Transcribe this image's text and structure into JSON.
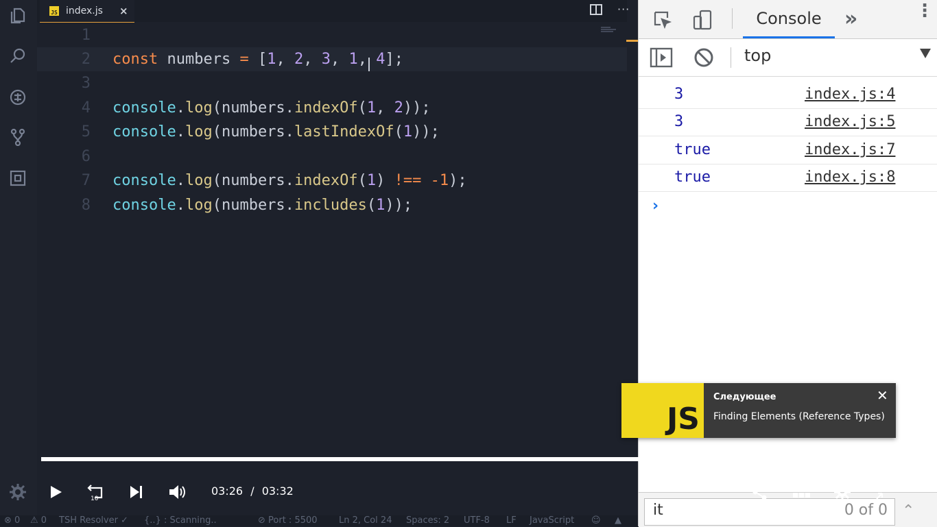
{
  "editor": {
    "tab": {
      "label": "index.js",
      "badge": "JS",
      "close": "×"
    },
    "more": "···",
    "lines": [
      {
        "num": "1"
      },
      {
        "num": "2"
      },
      {
        "num": "3"
      },
      {
        "num": "4"
      },
      {
        "num": "5"
      },
      {
        "num": "6"
      },
      {
        "num": "7"
      },
      {
        "num": "8"
      }
    ],
    "code": {
      "l2": {
        "kw": "const",
        "name": " numbers ",
        "op": "=",
        "open": " [",
        "n1": "1",
        "c1": ", ",
        "n2": "2",
        "c2": ", ",
        "n3": "3",
        "c3": ", ",
        "n4": "1",
        "c4": ", ",
        "n5": "4",
        "close": "];"
      },
      "l4": {
        "obj": "console",
        "dot": ".",
        "fn": "log",
        "p1": "(numbers.",
        "me": "indexOf",
        "p2": "(",
        "a1": "1",
        "c": ", ",
        "a2": "2",
        "p3": "));"
      },
      "l5": {
        "obj": "console",
        "dot": ".",
        "fn": "log",
        "p1": "(numbers.",
        "me": "lastIndexOf",
        "p2": "(",
        "a1": "1",
        "p3": "));"
      },
      "l7": {
        "obj": "console",
        "dot": ".",
        "fn": "log",
        "p1": "(numbers.",
        "me": "indexOf",
        "p2": "(",
        "a1": "1",
        "p3": ") ",
        "op": "!==",
        "sp": " ",
        "neg": "-1",
        "p4": ");"
      },
      "l8": {
        "obj": "console",
        "dot": ".",
        "fn": "log",
        "p1": "(numbers.",
        "me": "includes",
        "p2": "(",
        "a1": "1",
        "p3": "));"
      }
    }
  },
  "devtools": {
    "tab": "Console",
    "more_tabs": "»",
    "kebab": "⋮",
    "context": "top",
    "messages": [
      {
        "value": "3",
        "source": "index.js:4"
      },
      {
        "value": "3",
        "source": "index.js:5"
      },
      {
        "value": "true",
        "source": "index.js:7"
      },
      {
        "value": "true",
        "source": "index.js:8"
      }
    ],
    "prompt": "›",
    "find": {
      "value": "it",
      "count": "0 of 0"
    }
  },
  "player": {
    "progress": 0.97,
    "current": "03:26",
    "separator": "/",
    "duration": "03:32",
    "next": {
      "label": "Следующее",
      "title": "Finding Elements (Reference Types)",
      "thumb": "JS",
      "close": "✕"
    }
  },
  "statusbar": {
    "errors": "⊗ 0",
    "warnings": "⚠ 0",
    "resolver": "TSH Resolver ✓",
    "scanning": "{..} : Scanning..",
    "port": "⊘ Port : 5500",
    "position": "Ln 2, Col 24",
    "spaces": "Spaces: 2",
    "encoding": "UTF-8",
    "eol": "LF",
    "language": "JavaScript"
  },
  "colors": {
    "accent": "#e8a33d",
    "console_blue": "#1a73e8",
    "value_blue": "#1a1aa6",
    "js_yellow": "#f0d81e"
  }
}
